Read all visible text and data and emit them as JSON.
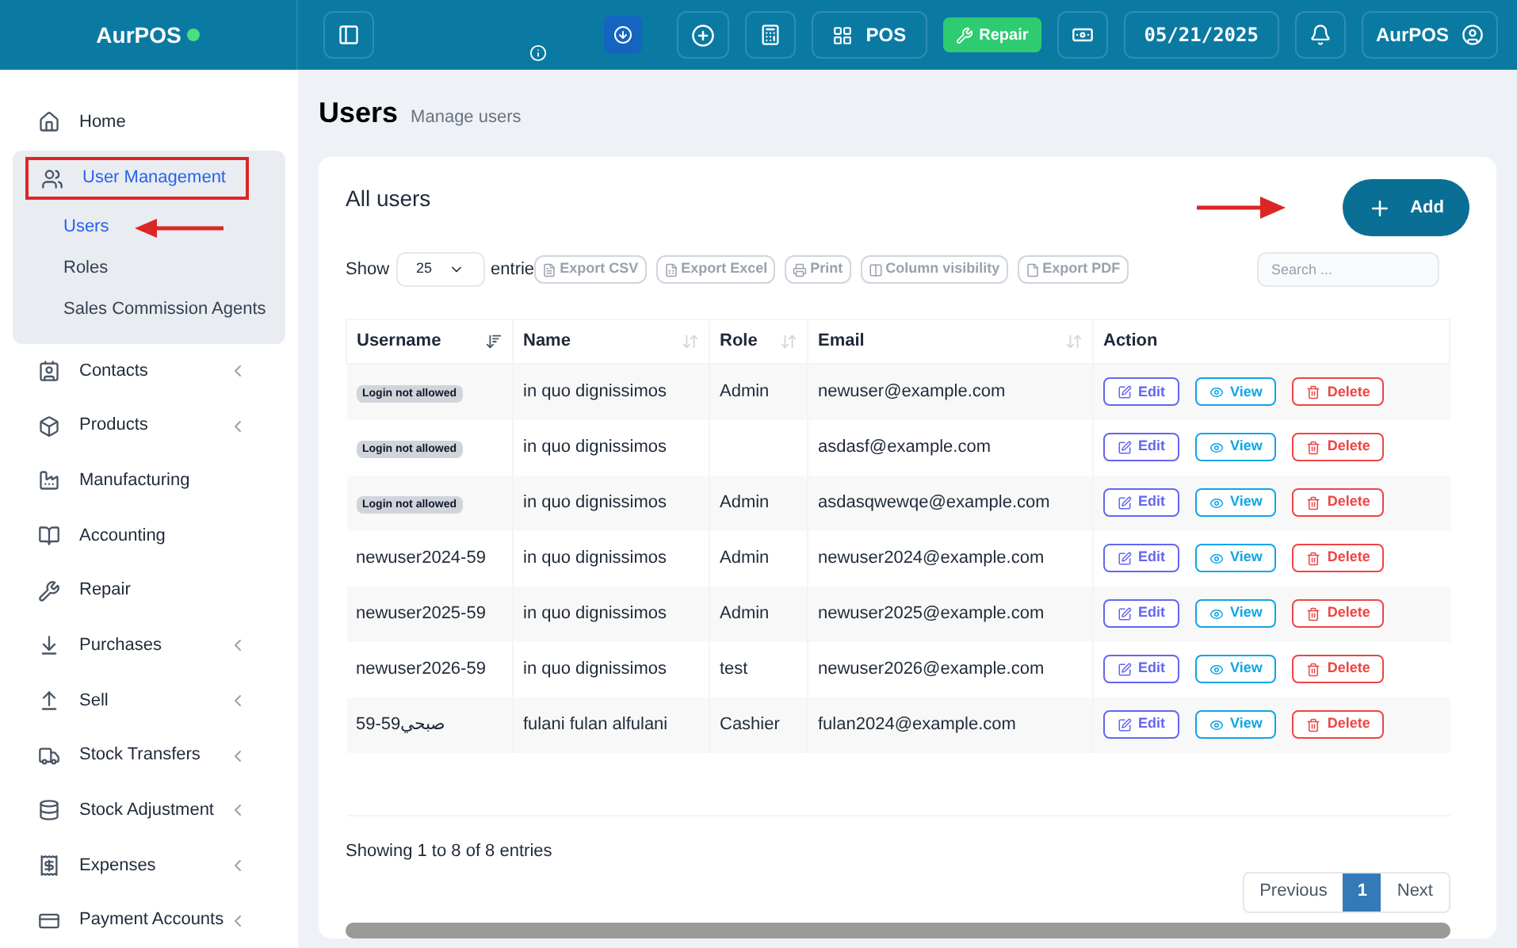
{
  "brand": {
    "name": "AurPOS",
    "online": true
  },
  "header": {
    "pos_label": "POS",
    "repair_label": "Repair",
    "date": "05/21/2025",
    "user": "AurPOS"
  },
  "sidebar": {
    "items": [
      {
        "label": "Home"
      },
      {
        "label": "User Management",
        "expanded": true,
        "highlighted": true,
        "children": [
          {
            "label": "Users",
            "selected": true
          },
          {
            "label": "Roles",
            "selected": false
          },
          {
            "label": "Sales Commission Agents",
            "selected": false
          }
        ]
      },
      {
        "label": "Contacts",
        "expanded": false
      },
      {
        "label": "Products",
        "expanded": false
      },
      {
        "label": "Manufacturing"
      },
      {
        "label": "Accounting"
      },
      {
        "label": "Repair"
      },
      {
        "label": "Purchases",
        "expanded": false
      },
      {
        "label": "Sell",
        "expanded": false
      },
      {
        "label": "Stock Transfers",
        "expanded": false
      },
      {
        "label": "Stock Adjustment",
        "expanded": false
      },
      {
        "label": "Expenses",
        "expanded": false
      },
      {
        "label": "Payment Accounts",
        "expanded": false
      }
    ]
  },
  "page": {
    "title": "Users",
    "subtitle": "Manage users"
  },
  "card": {
    "title": "All users",
    "add_label": "Add",
    "show_label": "Show",
    "page_size": "25",
    "entries_label": "entrie",
    "export_buttons": [
      "Export CSV",
      "Export Excel",
      "Print",
      "Column visibility",
      "Export PDF"
    ],
    "search": {
      "placeholder": "Search ..."
    },
    "table": {
      "columns": [
        {
          "label": "Username",
          "sorted": true
        },
        {
          "label": "Name",
          "sorted": false
        },
        {
          "label": "Role",
          "sorted": false
        },
        {
          "label": "Email",
          "sorted": false
        },
        {
          "label": "Action"
        }
      ],
      "rows": [
        {
          "username": {
            "kind": "badge",
            "text": "Login not allowed"
          },
          "name": "in quo dignissimos",
          "role": "Admin",
          "email": "newuser@example.com",
          "actions": [
            "Edit",
            "View",
            "Delete"
          ]
        },
        {
          "username": {
            "kind": "badge",
            "text": "Login not allowed"
          },
          "name": "in quo dignissimos",
          "email": "asdasf@example.com",
          "actions": [
            "Edit",
            "View",
            "Delete"
          ]
        },
        {
          "username": {
            "kind": "badge",
            "text": "Login not allowed"
          },
          "name": "in quo dignissimos",
          "role": "Admin",
          "email": "asdasqwewqe@example.com",
          "actions": [
            "Edit",
            "View",
            "Delete"
          ]
        },
        {
          "username": {
            "kind": "text",
            "text": "newuser2024-59"
          },
          "name": "in quo dignissimos",
          "role": "Admin",
          "email": "newuser2024@example.com",
          "actions": [
            "Edit",
            "View",
            "Delete"
          ]
        },
        {
          "username": {
            "kind": "text",
            "text": "newuser2025-59"
          },
          "name": "in quo dignissimos",
          "role": "Admin",
          "email": "newuser2025@example.com",
          "actions": [
            "Edit",
            "View",
            "Delete"
          ]
        },
        {
          "username": {
            "kind": "text",
            "text": "newuser2026-59"
          },
          "name": "in quo dignissimos",
          "role": "test",
          "email": "newuser2026@example.com",
          "actions": [
            "Edit",
            "View",
            "Delete"
          ]
        },
        {
          "username": {
            "kind": "text",
            "text": "صبحي59-59"
          },
          "name": "fulani fulan alfulani",
          "role": "Cashier",
          "email": "fulan2024@example.com",
          "actions": [
            "Edit",
            "View",
            "Delete"
          ]
        }
      ]
    },
    "footer": "Showing 1 to 8 of 8 entries",
    "pagination": {
      "previous": "Previous",
      "pages": [
        {
          "label": "1",
          "selected": true
        }
      ],
      "next": "Next"
    }
  }
}
